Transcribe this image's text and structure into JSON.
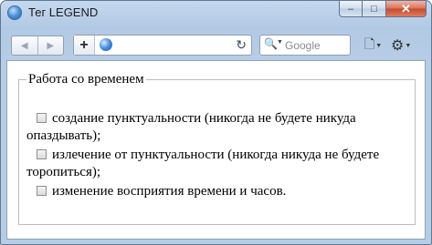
{
  "window": {
    "title": "Тег LEGEND",
    "buttons": {
      "minimize": "–",
      "maximize": "□",
      "close": "✕"
    }
  },
  "toolbar": {
    "back_icon": "◀",
    "forward_icon": "▶",
    "new_tab_icon": "+",
    "reload_icon": "↻",
    "search_placeholder": "Google",
    "search_icon": "🔍",
    "page_icon": "🗋",
    "tools_icon": "⚙",
    "caret": "▼"
  },
  "fieldset": {
    "legend": "Работа со временем",
    "items": [
      {
        "label": "создание пунктуальности (никогда не будете никуда опаздывать);",
        "checked": false
      },
      {
        "label": "излечение от пунктуальности (никогда никуда не будете торопиться);",
        "checked": false
      },
      {
        "label": "изменение восприятия времени и часов.",
        "checked": false
      }
    ]
  }
}
